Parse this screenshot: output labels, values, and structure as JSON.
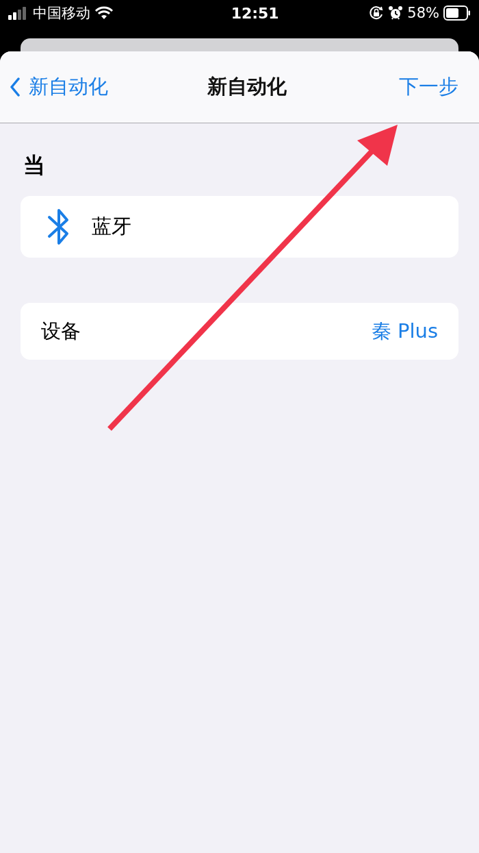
{
  "status_bar": {
    "carrier": "中国移动",
    "time": "12:51",
    "battery": "58%"
  },
  "nav_bar": {
    "back": "新自动化",
    "title": "新自动化",
    "next": "下一步"
  },
  "section": {
    "header": "当"
  },
  "trigger": {
    "label": "蓝牙"
  },
  "settings": [
    {
      "label": "设备",
      "value": "秦 Plus"
    }
  ]
}
